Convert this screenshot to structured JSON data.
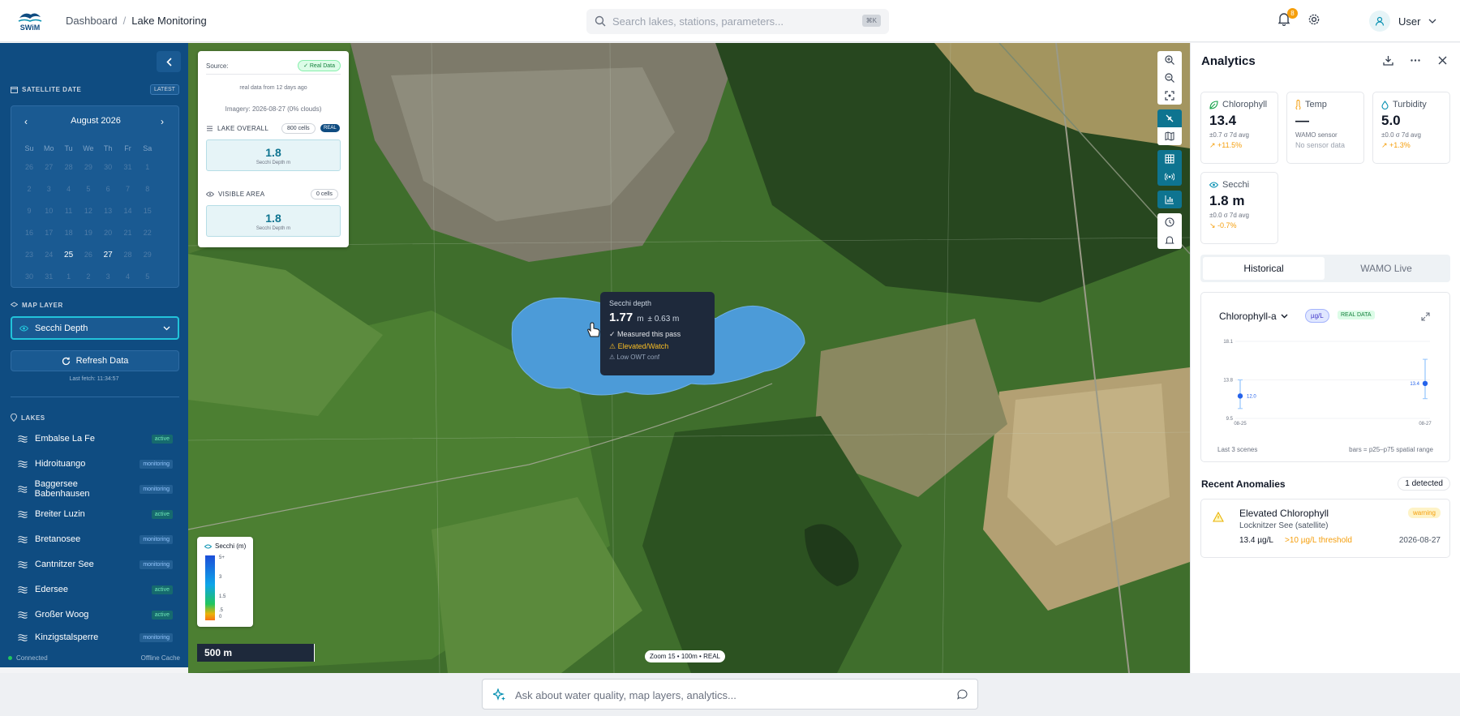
{
  "header": {
    "logo_text": "SWiM",
    "breadcrumb": [
      "Dashboard",
      "Lake Monitoring"
    ],
    "search_placeholder": "Search lakes, stations, parameters...",
    "search_shortcut": "⌘K",
    "notif_count": "8",
    "user_label": "User"
  },
  "sidebar": {
    "satellite_label": "SATELLITE DATE",
    "latest_badge": "LATEST",
    "calendar": {
      "month": "August 2026",
      "weekdays": [
        "Su",
        "Mo",
        "Tu",
        "We",
        "Th",
        "Fr",
        "Sa"
      ],
      "weeks": [
        [
          "26",
          "27",
          "28",
          "29",
          "30",
          "31",
          "1"
        ],
        [
          "2",
          "3",
          "4",
          "5",
          "6",
          "7",
          "8"
        ],
        [
          "9",
          "10",
          "11",
          "12",
          "13",
          "14",
          "15"
        ],
        [
          "16",
          "17",
          "18",
          "19",
          "20",
          "21",
          "22"
        ],
        [
          "23",
          "24",
          "25",
          "26",
          "27",
          "28",
          "29"
        ],
        [
          "30",
          "31",
          "1",
          "2",
          "3",
          "4",
          "5"
        ]
      ]
    },
    "map_layer_label": "MAP LAYER",
    "map_layer_value": "Secchi Depth",
    "refresh_label": "Refresh Data",
    "last_fetch": "Last fetch: 11:34:57",
    "lakes_label": "LAKES",
    "lakes": [
      {
        "name": "Embalse La Fe",
        "status": "active"
      },
      {
        "name": "Hidroituango",
        "status": "monitoring"
      },
      {
        "name": "Baggersee Babenhausen",
        "status": "monitoring"
      },
      {
        "name": "Breiter Luzin",
        "status": "active"
      },
      {
        "name": "Bretanosee",
        "status": "monitoring"
      },
      {
        "name": "Cantnitzer See",
        "status": "monitoring"
      },
      {
        "name": "Edersee",
        "status": "active"
      },
      {
        "name": "Großer Woog",
        "status": "active"
      },
      {
        "name": "Kinzigstalsperre",
        "status": "monitoring"
      }
    ],
    "footer_status": "Connected",
    "footer_cache": "Offline Cache"
  },
  "map": {
    "source_label": "Source:",
    "source_badge": "✓ Real Data",
    "real_data_note": "real data from 12 days ago",
    "imagery": "Imagery: 2026-08-27 (0% clouds)",
    "lake_overall_label": "LAKE OVERALL",
    "lake_overall_cells": "800 cells",
    "real_badge": "REAL",
    "lake_overall_value": "1.8",
    "value_sub": "Secchi Depth m",
    "visible_area_label": "VISIBLE AREA",
    "visible_cells": "0 cells",
    "visible_value": "1.8",
    "tooltip": {
      "title": "Secchi depth",
      "value": "1.77",
      "unit": "m",
      "err": "± 0.63 m",
      "measured": "✓ Measured this pass",
      "status": "⚠ Elevated/Watch",
      "conf": "⚠ Low OWT conf"
    },
    "legend_title": "Secchi (m)",
    "legend_ticks": [
      "5+",
      "3",
      "1.5",
      ".5",
      "0"
    ],
    "scale_label": "500 m",
    "zoom_label": "Zoom 15 • 100m • REAL"
  },
  "analytics": {
    "title": "Analytics",
    "metrics": [
      {
        "name": "Chlorophyll",
        "value": "13.4",
        "sub": "±0.7 σ 7d avg",
        "delta": "↗ +11.5%"
      },
      {
        "name": "Temp",
        "value": "—",
        "sub": "WAMO sensor",
        "delta": "No sensor data"
      },
      {
        "name": "Turbidity",
        "value": "5.0",
        "sub": "±0.0 σ 7d avg",
        "delta": "↗ +1.3%"
      },
      {
        "name": "Secchi",
        "value": "1.8 m",
        "sub": "±0.0 σ 7d avg",
        "delta": "↘ -0.7%"
      }
    ],
    "tabs": [
      "Historical",
      "WAMO Live"
    ],
    "chart_title": "Chlorophyll-a",
    "unit_pill": "µg/L",
    "real_pill": "REAL DATA",
    "footnote_left": "Last 3 scenes",
    "footnote_right": "bars = p25–p75 spatial range",
    "anomalies_title": "Recent Anomalies",
    "anomalies_count": "1 detected",
    "anomaly": {
      "title": "Elevated Chlorophyll",
      "badge": "warning",
      "subtitle": "Locknitzer See (satellite)",
      "value": "13.4 µg/L",
      "threshold": ">10 µg/L threshold",
      "date": "2026-08-27"
    }
  },
  "chart_data": {
    "type": "scatter",
    "title": "Chlorophyll-a",
    "ylabel": "µg/L",
    "ylim": [
      9.5,
      18.1
    ],
    "yticks": [
      "18.1",
      "13.8",
      "9.5"
    ],
    "x": [
      "08-25",
      "08-27"
    ],
    "values": [
      12.0,
      13.4
    ],
    "value_labels": [
      "12.0",
      "13.4"
    ],
    "ranges": [
      [
        10.6,
        13.8
      ],
      [
        11.7,
        16.1
      ]
    ]
  },
  "assistant": {
    "placeholder": "Ask about water quality, map layers, analytics..."
  },
  "colors": {
    "sidebar": "#0f4c81",
    "accent": "#0e7490",
    "warning": "#f59e0b"
  }
}
